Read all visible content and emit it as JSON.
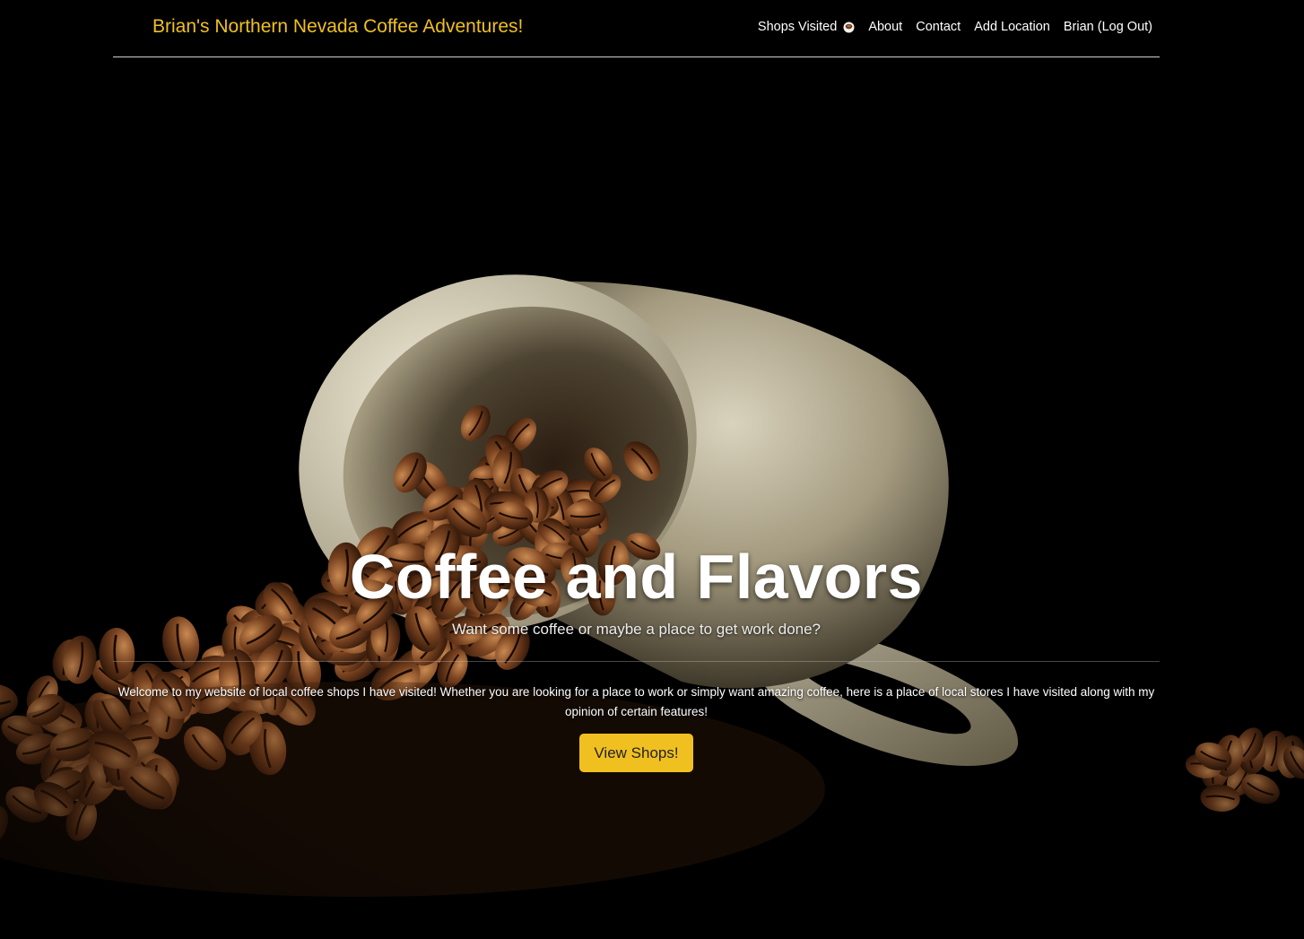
{
  "navbar": {
    "brand": "Brian's Northern Nevada Coffee Adventures!",
    "links": [
      {
        "label": "Shops Visited",
        "icon": "coffee-cup-icon"
      },
      {
        "label": "About"
      },
      {
        "label": "Contact"
      },
      {
        "label": "Add Location"
      },
      {
        "label": "Brian (Log Out)"
      }
    ]
  },
  "hero": {
    "title": "Coffee and Flavors",
    "subtitle": "Want some coffee or maybe a place to get work done?",
    "lead": "Welcome to my website of local coffee shops I have visited! Whether you are looking for a place to work or simply want amazing coffee, here is a place of local stores I have visited along with my opinion of certain features!",
    "button_label": "View Shops!"
  },
  "colors": {
    "accent": "#f0c020",
    "background": "#000000",
    "text": "#ffffff"
  }
}
